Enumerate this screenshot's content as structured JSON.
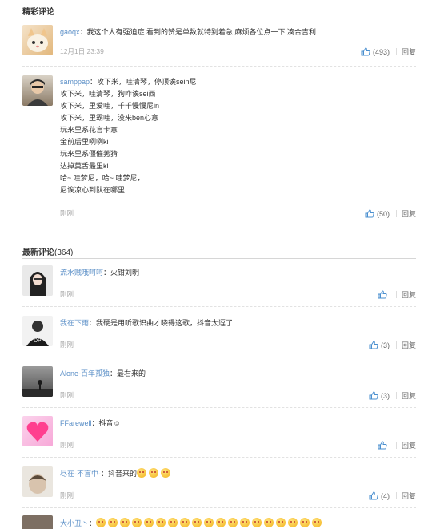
{
  "hot": {
    "title": "精彩评论",
    "comments": [
      {
        "user": "gaoqx",
        "sep": "：",
        "lines": [
          "我这个人有强迫症 看到的赞是单数就特别着急 麻烦各位点一下 凑合吉利"
        ],
        "time": "12月1日 23:39",
        "likes": "(493)",
        "reply": "回复"
      },
      {
        "user": "samppap",
        "sep": "：",
        "lines": [
          "攻下米，哇清琴，停顶诶sein尼",
          "攻下米，哇清琴，狗咋诶sei西",
          "攻下米，里爱哇，千千慢慢尼in",
          "攻下米，里霸哇，没来ben心意",
          "玩来里系花言卡意",
          "金前后里咧咧ki",
          "玩来里系僵催莠猜",
          "达掉莫舌最里ki",
          "哈~ 哇梦尼，哈~ 哇梦尼，",
          "尼诶凉心到队在哪里"
        ],
        "time": "刚刚",
        "likes": "(50)",
        "reply": "回复"
      }
    ]
  },
  "latest": {
    "title": "最新评论",
    "count": "(364)",
    "comments": [
      {
        "user": "流水贼哦呵呵",
        "sep": "：",
        "text": "火钳刘明",
        "time": "刚刚",
        "likes": "",
        "reply": "回复"
      },
      {
        "user": "我在下雨",
        "sep": "：",
        "text": "我硬是用听歌识曲才晓得这歌，抖音太逗了",
        "time": "刚刚",
        "likes": "(3)",
        "reply": "回复"
      },
      {
        "user": "Alone-百年孤独",
        "sep": "：",
        "text": "最右来的",
        "time": "刚刚",
        "likes": "(3)",
        "reply": "回复"
      },
      {
        "user": "FFarewell",
        "sep": "：",
        "text": "抖音☺",
        "time": "刚刚",
        "likes": "",
        "reply": "回复"
      },
      {
        "user": "尽在-不言中-",
        "sep": "：",
        "text": "抖音来的",
        "time": "刚刚",
        "likes": "(4)",
        "reply": "回复"
      },
      {
        "user": "大小丑丶",
        "sep": "：",
        "text": "",
        "time": "",
        "likes": "",
        "reply": ""
      }
    ]
  },
  "colors": {
    "username": "#5b8fc7",
    "muted": "#aaaaaa",
    "like_icon": "#4a8fcf"
  }
}
